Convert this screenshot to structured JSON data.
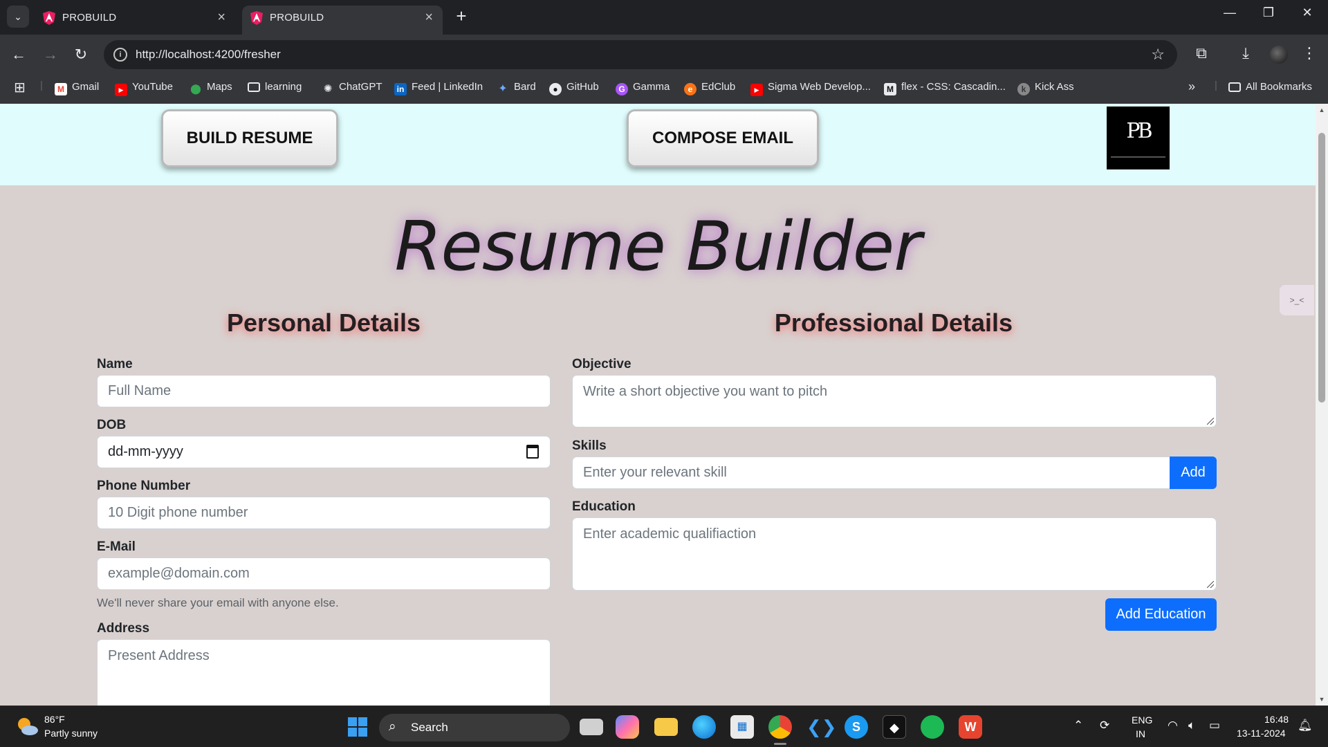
{
  "browser": {
    "tabs": [
      {
        "title": "PROBUILD",
        "active": false
      },
      {
        "title": "PROBUILD",
        "active": true
      }
    ],
    "url": "http://localhost:4200/fresher",
    "bookmarks": [
      {
        "label": "Gmail",
        "icon": "gmail-icon"
      },
      {
        "label": "YouTube",
        "icon": "youtube-icon"
      },
      {
        "label": "Maps",
        "icon": "maps-icon"
      },
      {
        "label": "learning",
        "icon": "folder-icon"
      },
      {
        "label": "ChatGPT",
        "icon": "chatgpt-icon"
      },
      {
        "label": "Feed | LinkedIn",
        "icon": "linkedin-icon"
      },
      {
        "label": "Bard",
        "icon": "bard-icon"
      },
      {
        "label": "GitHub",
        "icon": "github-icon"
      },
      {
        "label": "Gamma",
        "icon": "gamma-icon"
      },
      {
        "label": "EdClub",
        "icon": "edclub-icon"
      },
      {
        "label": "Sigma Web Develop...",
        "icon": "youtube-icon"
      },
      {
        "label": "flex - CSS: Cascadin...",
        "icon": "mdn-icon"
      },
      {
        "label": "Kick Ass",
        "icon": "kickass-icon"
      }
    ],
    "all_bookmarks": "All Bookmarks"
  },
  "header": {
    "build_resume": "BUILD RESUME",
    "compose_email": "COMPOSE EMAIL",
    "logo_text": "PB"
  },
  "page": {
    "title": "Resume Builder",
    "personal": {
      "heading": "Personal Details",
      "name_label": "Name",
      "name_placeholder": "Full Name",
      "dob_label": "DOB",
      "dob_value": "dd-mm-yyyy",
      "phone_label": "Phone Number",
      "phone_placeholder": "10 Digit phone number",
      "email_label": "E-Mail",
      "email_placeholder": "example@domain.com",
      "email_help": "We'll never share your email with anyone else.",
      "address_label": "Address",
      "address_placeholder": "Present Address"
    },
    "professional": {
      "heading": "Professional Details",
      "objective_label": "Objective",
      "objective_placeholder": "Write a short objective you want to pitch",
      "skills_label": "Skills",
      "skills_placeholder": "Enter your relevant skill",
      "add_skill": "Add",
      "education_label": "Education",
      "education_placeholder": "Enter academic qualifiaction",
      "add_education": "Add Education"
    }
  },
  "taskbar": {
    "temperature": "86°F",
    "weather": "Partly sunny",
    "search": "Search",
    "lang_top": "ENG",
    "lang_bottom": "IN",
    "time": "16:48",
    "date": "13-11-2024"
  }
}
